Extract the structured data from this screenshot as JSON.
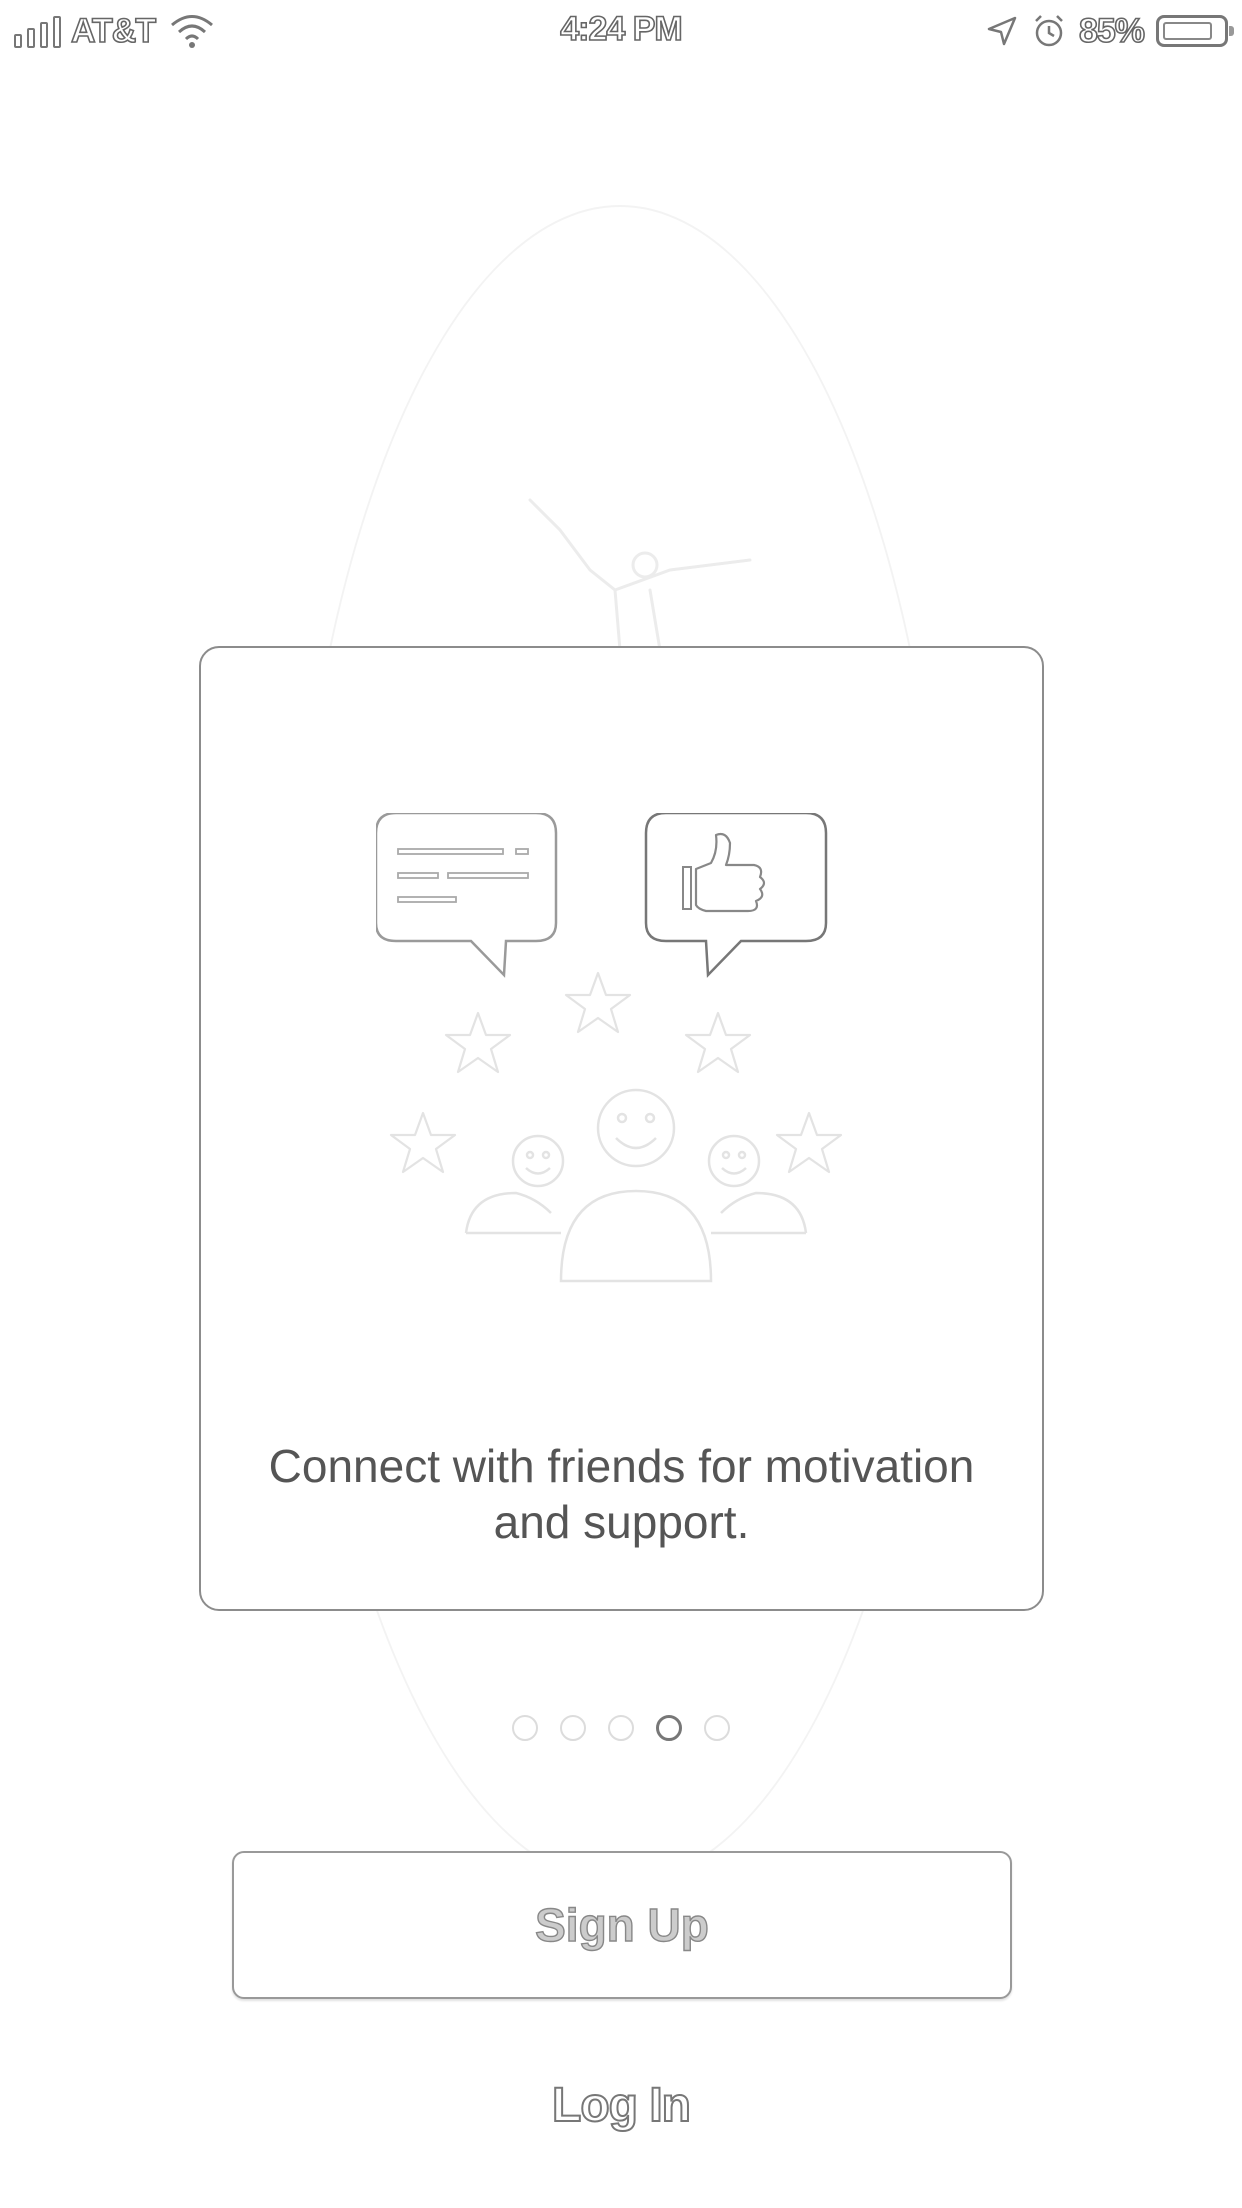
{
  "status_bar": {
    "carrier": "AT&T",
    "time": "4:24 PM",
    "battery_percent": "85%",
    "battery_level": 0.85,
    "icons": [
      "signal-icon",
      "wifi-icon",
      "location-arrow-icon",
      "alarm-icon",
      "battery-icon"
    ]
  },
  "onboarding": {
    "card_text": "Connect with friends for motivation and support.",
    "illustration_icons": [
      "chat-bubble-icon",
      "thumbs-up-bubble-icon",
      "star-icon",
      "people-group-icon"
    ],
    "page_count": 5,
    "active_page": 4
  },
  "actions": {
    "signup_label": "Sign Up",
    "login_label": "Log In"
  },
  "colors": {
    "outline": "#8c8c8c",
    "text": "#555555",
    "faint": "#e6e6e6"
  }
}
